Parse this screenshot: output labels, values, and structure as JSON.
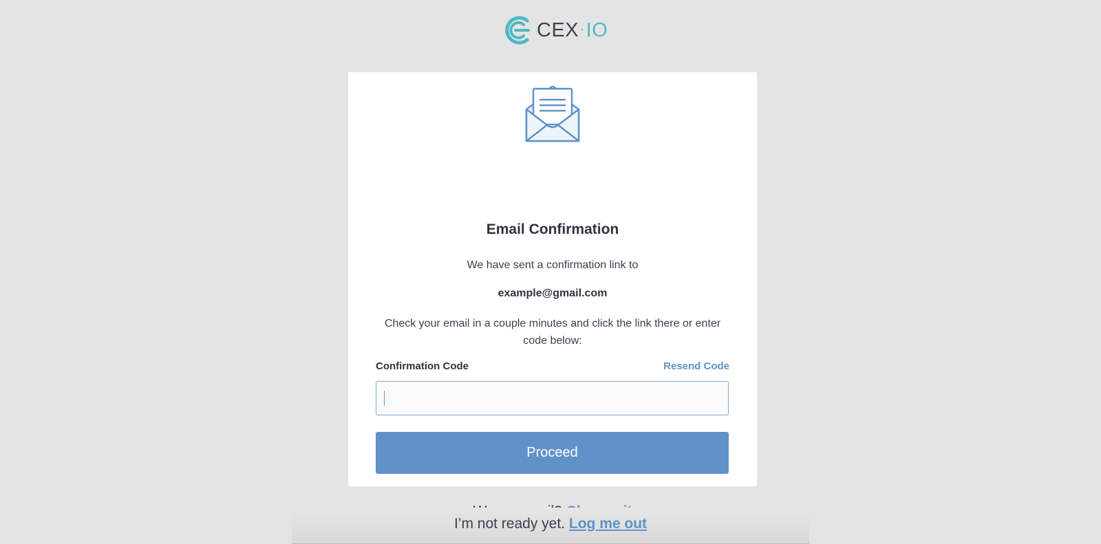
{
  "brand": {
    "logo_text": "CEX",
    "logo_dot": "·",
    "logo_suffix": "IO",
    "accent_color": "#4fb8c4"
  },
  "card": {
    "icon": "envelope-letter-icon",
    "title": "Email Confirmation",
    "sent_line": "We have sent a confirmation link to",
    "email": "example@gmail.com",
    "instructions": "Check your email in a couple minutes and click the link there or enter code below:",
    "code_label": "Confirmation Code",
    "resend_label": "Resend Code",
    "code_value": "",
    "proceed_label": "Proceed",
    "wrong_prefix": "Wrong email?",
    "change_label": "Change it"
  },
  "footer": {
    "prefix": "I’m not ready yet.",
    "logout_label": "Log me out"
  },
  "colors": {
    "primary": "#6092c9",
    "link": "#5f93c8",
    "background": "#e4e4e4"
  }
}
